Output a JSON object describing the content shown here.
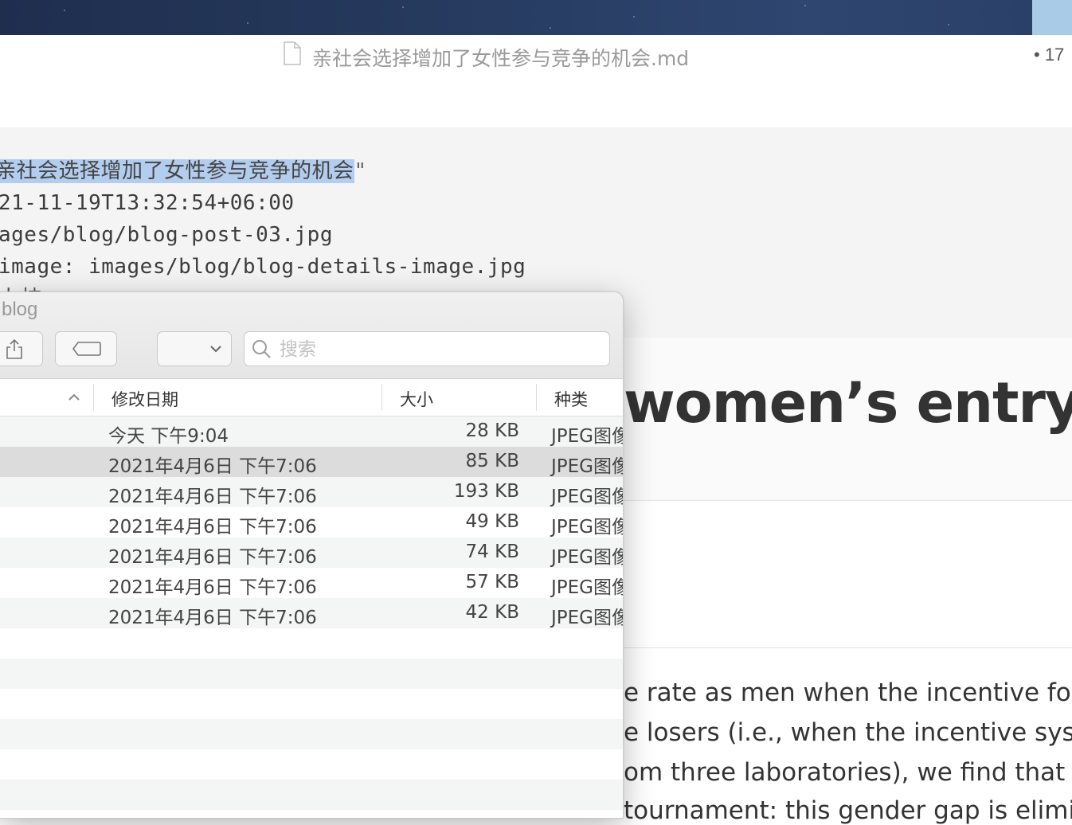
{
  "editor": {
    "title": "亲社会选择增加了女性参与竞争的机会.md",
    "word_count": "• 17",
    "frontmatter": {
      "title_line_selected": "亲社会选择增加了女性参与竞争的机会",
      "title_line_quote": "\"",
      "date_line": "21-11-19T13:32:54+06:00",
      "image_line": "ages/blog/blog-post-03.jpg",
      "bg_image_line": "image: images/blog/blog-details-image.jpg",
      "partial_line": "卜技"
    },
    "heading": "women’s entry",
    "body_lines": [
      "e rate as men when the incentive for",
      "e losers (i.e., when the incentive systen",
      "om three laboratories), we find that ab",
      "tournament: this gender gap is elimin"
    ]
  },
  "finder": {
    "title": "blog",
    "search_placeholder": "搜索",
    "columns": {
      "date": "修改日期",
      "size": "大小",
      "kind": "种类"
    },
    "rows": [
      {
        "date": "今天 下午9:04",
        "size": "28 KB",
        "kind": "JPEG图像"
      },
      {
        "date": "2021年4月6日 下午7:06",
        "size": "85 KB",
        "kind": "JPEG图像"
      },
      {
        "date": "2021年4月6日 下午7:06",
        "size": "193 KB",
        "kind": "JPEG图像"
      },
      {
        "date": "2021年4月6日 下午7:06",
        "size": "49 KB",
        "kind": "JPEG图像"
      },
      {
        "date": "2021年4月6日 下午7:06",
        "size": "74 KB",
        "kind": "JPEG图像"
      },
      {
        "date": "2021年4月6日 下午7:06",
        "size": "57 KB",
        "kind": "JPEG图像"
      },
      {
        "date": "2021年4月6日 下午7:06",
        "size": "42 KB",
        "kind": "JPEG图像"
      }
    ],
    "selected_row_index": 1
  },
  "colors": {
    "selection": "#b3cdee",
    "row_selected": "#dcdcdc",
    "row_alt": "#f4f5f5",
    "desktop": "#263a5e"
  },
  "icons": [
    "document-icon",
    "share-icon",
    "tag-icon",
    "view-options-icon",
    "chevron-down-icon",
    "search-icon",
    "sort-ascending-icon"
  ]
}
